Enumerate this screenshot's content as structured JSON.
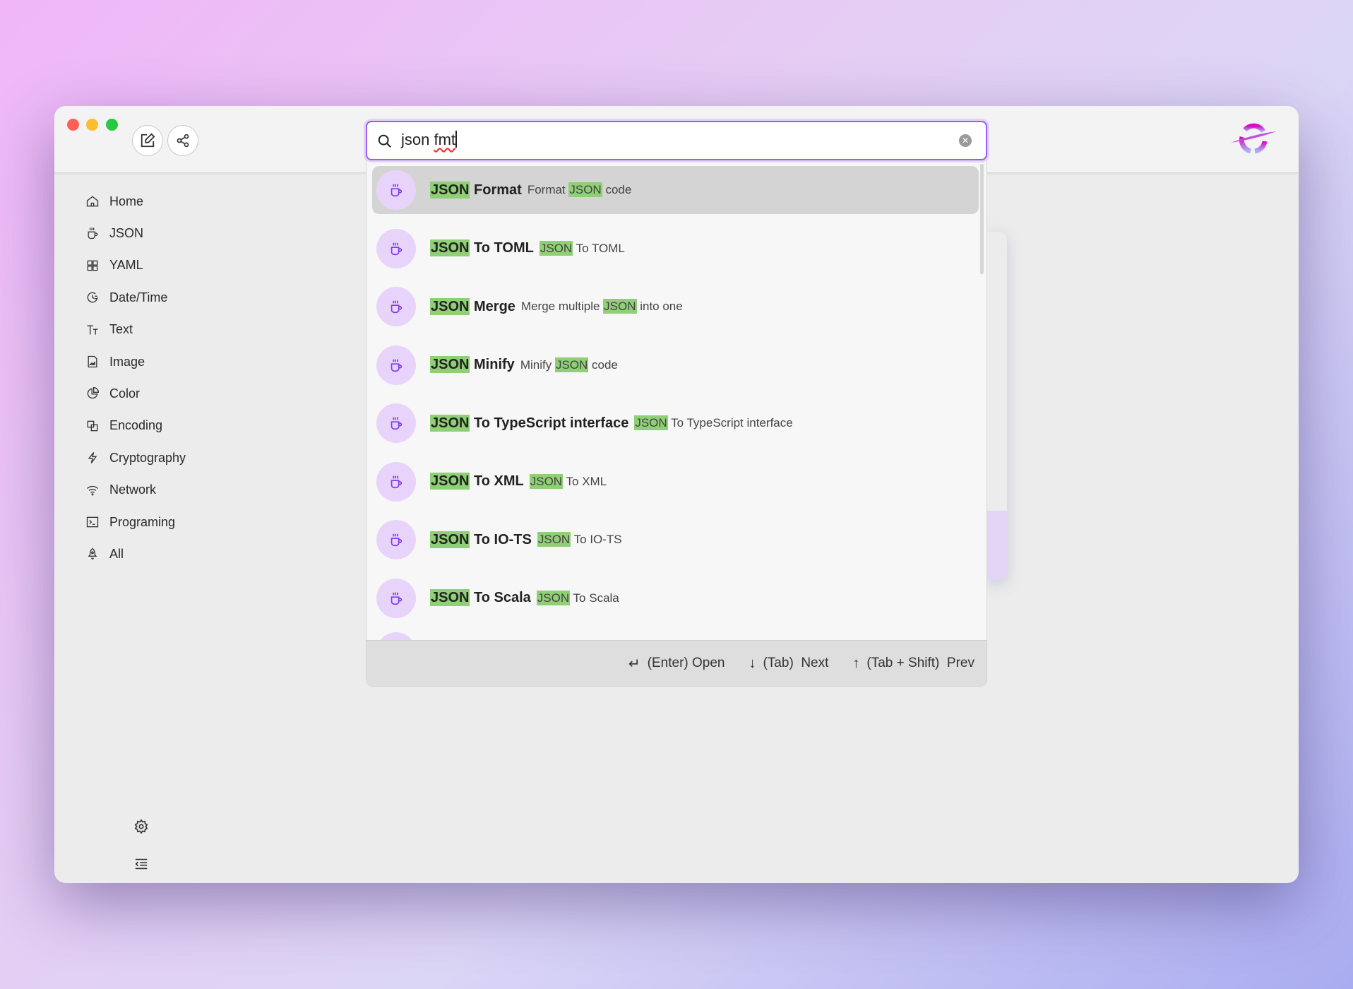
{
  "search": {
    "query_word1": "json",
    "query_word2": "fmt",
    "clear_icon": "close-circle-icon"
  },
  "toolbar": {
    "edit_icon": "edit-icon",
    "share_icon": "share-icon"
  },
  "sidebar": {
    "items": [
      {
        "label": "Home",
        "icon": "home-icon"
      },
      {
        "label": "JSON",
        "icon": "cup-icon"
      },
      {
        "label": "YAML",
        "icon": "grid-icon"
      },
      {
        "label": "Date/Time",
        "icon": "clock-icon"
      },
      {
        "label": "Text",
        "icon": "text-size-icon"
      },
      {
        "label": "Image",
        "icon": "image-file-icon"
      },
      {
        "label": "Color",
        "icon": "pie-icon"
      },
      {
        "label": "Encoding",
        "icon": "squares-icon"
      },
      {
        "label": "Cryptography",
        "icon": "bolt-icon"
      },
      {
        "label": "Network",
        "icon": "wifi-icon"
      },
      {
        "label": "Programing",
        "icon": "terminal-icon"
      },
      {
        "label": "All",
        "icon": "rocket-icon"
      }
    ]
  },
  "results": [
    {
      "hl": "JSON",
      "title": " Format",
      "desc": [
        {
          "t": "Format "
        },
        {
          "t": "JSON",
          "hl": true
        },
        {
          "t": " code"
        }
      ],
      "selected": true
    },
    {
      "hl": "JSON",
      "title": " To TOML",
      "desc": [
        {
          "t": "JSON",
          "hl": true
        },
        {
          "t": " To TOML"
        }
      ]
    },
    {
      "hl": "JSON",
      "title": " Merge",
      "desc": [
        {
          "t": "Merge multiple "
        },
        {
          "t": "JSON",
          "hl": true
        },
        {
          "t": " into one"
        }
      ]
    },
    {
      "hl": "JSON",
      "title": " Minify",
      "desc": [
        {
          "t": "Minify "
        },
        {
          "t": "JSON",
          "hl": true
        },
        {
          "t": " code"
        }
      ]
    },
    {
      "hl": "JSON",
      "title": " To TypeScript interface",
      "desc": [
        {
          "t": "JSON",
          "hl": true
        },
        {
          "t": " To TypeScript interface"
        }
      ]
    },
    {
      "hl": "JSON",
      "title": " To XML",
      "desc": [
        {
          "t": "JSON",
          "hl": true
        },
        {
          "t": " To XML"
        }
      ]
    },
    {
      "hl": "JSON",
      "title": " To IO-TS",
      "desc": [
        {
          "t": "JSON",
          "hl": true
        },
        {
          "t": " To IO-TS"
        }
      ]
    },
    {
      "hl": "JSON",
      "title": " To Scala",
      "desc": [
        {
          "t": "JSON",
          "hl": true
        },
        {
          "t": " To Scala"
        }
      ]
    }
  ],
  "footer": {
    "hints": [
      {
        "key": "↵",
        "label": "(Enter) Open"
      },
      {
        "key": "↓",
        "label": "(Tab)  Next"
      },
      {
        "key": "↑",
        "label": "(Tab + Shift)  Prev"
      }
    ]
  },
  "colors": {
    "accent": "#9b5cf6",
    "highlight": "#8fcf75",
    "icon_bg": "#e8d4fa",
    "icon_fg": "#7c3aed"
  }
}
